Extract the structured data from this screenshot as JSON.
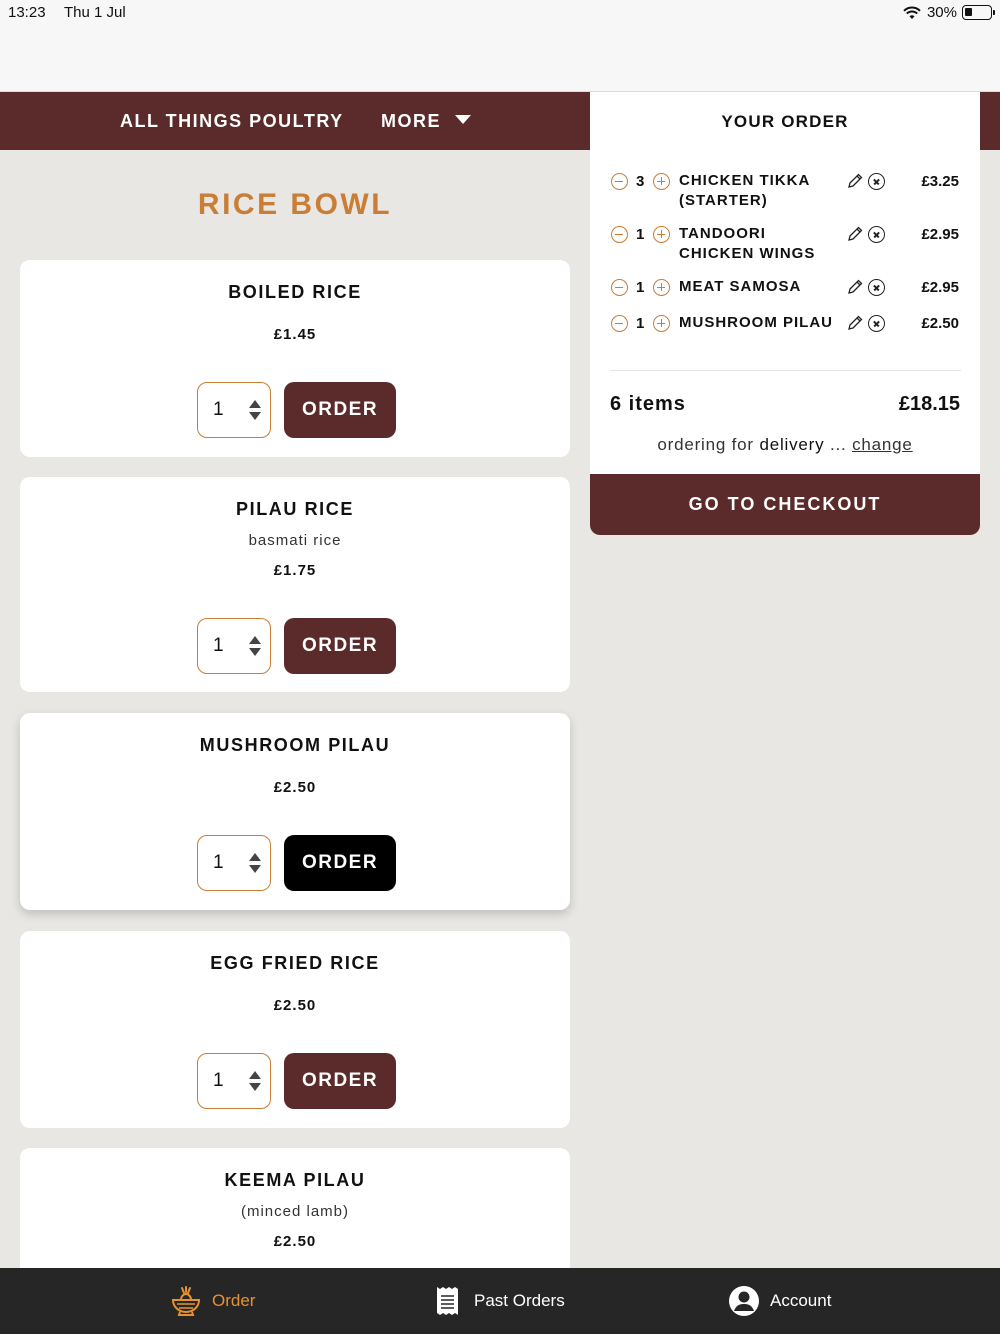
{
  "status_bar": {
    "time": "13:23",
    "date": "Thu 1 Jul",
    "battery": "30%"
  },
  "nav": {
    "poultry_label": "ALL THINGS POULTRY",
    "more_label": "MORE"
  },
  "section": {
    "title": "RICE BOWL"
  },
  "menu_items": [
    {
      "name": "BOILED RICE",
      "description": "",
      "price": "£1.45",
      "qty": "1",
      "order_label": "ORDER"
    },
    {
      "name": "PILAU RICE",
      "description": "basmati rice",
      "price": "£1.75",
      "qty": "1",
      "order_label": "ORDER"
    },
    {
      "name": "MUSHROOM PILAU",
      "description": "",
      "price": "£2.50",
      "qty": "1",
      "order_label": "ORDER"
    },
    {
      "name": "EGG FRIED RICE",
      "description": "",
      "price": "£2.50",
      "qty": "1",
      "order_label": "ORDER"
    },
    {
      "name": "KEEMA PILAU",
      "description": "(minced lamb)",
      "price": "£2.50"
    }
  ],
  "order": {
    "title": "YOUR ORDER",
    "lines": [
      {
        "qty": "3",
        "name": "CHICKEN TIKKA (STARTER)",
        "price": "£3.25"
      },
      {
        "qty": "1",
        "name": "TANDOORI CHICKEN WINGS",
        "price": "£2.95"
      },
      {
        "qty": "1",
        "name": "MEAT SAMOSA",
        "price": "£2.95"
      },
      {
        "qty": "1",
        "name": "MUSHROOM PILAU",
        "price": "£2.50"
      }
    ],
    "item_count": "6 items",
    "total": "£18.15",
    "delivery_prefix": "ordering for",
    "delivery_mode": "delivery",
    "delivery_ellipsis": "...",
    "change_label": "change",
    "checkout_label": "GO TO CHECKOUT"
  },
  "tabs": [
    {
      "label": "Order",
      "icon": "food-bowl-icon",
      "active": true
    },
    {
      "label": "Past Orders",
      "icon": "receipt-icon",
      "active": false
    },
    {
      "label": "Account",
      "icon": "user-circle-icon",
      "active": false
    }
  ],
  "colors": {
    "brand": "#5b2b2b",
    "accent": "#c97d35",
    "active_tab": "#e8922f",
    "background": "#e9e7e4"
  }
}
